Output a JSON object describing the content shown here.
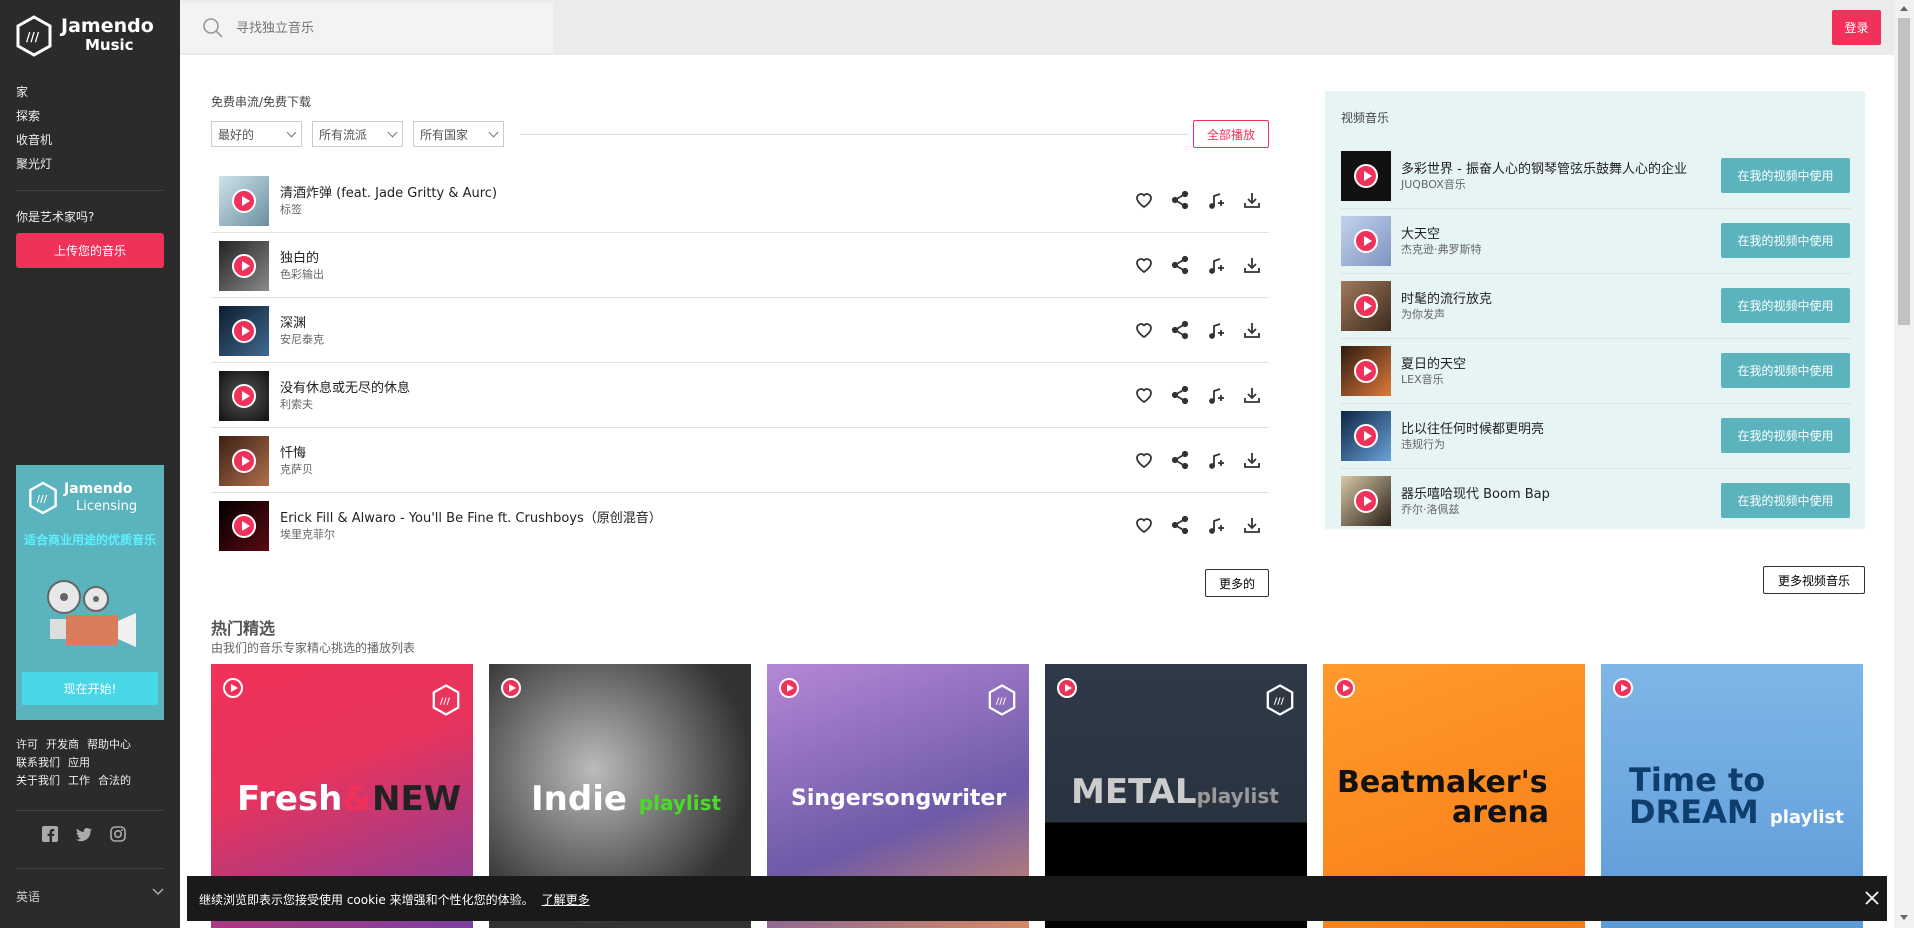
{
  "brand": {
    "name_line1": "Jamendo",
    "name_line2": "Music"
  },
  "sidebar": {
    "nav": [
      {
        "label": "家"
      },
      {
        "label": "探索"
      },
      {
        "label": "收音机"
      },
      {
        "label": "聚光灯"
      }
    ],
    "artist_question": "你是艺术家吗?",
    "upload_label": "上传您的音乐",
    "licensing": {
      "name_line1": "Jamendo",
      "name_line2": "Licensing",
      "tagline": "适合商业用途的优质音乐",
      "cta": "现在开始!"
    },
    "footer_links": [
      "许可",
      "开发商",
      "帮助中心",
      "联系我们",
      "应用",
      "关于我们",
      "工作",
      "合法的"
    ],
    "language": "英语"
  },
  "search": {
    "placeholder": "寻找独立音乐"
  },
  "header": {
    "login_label": "登录"
  },
  "tracks_section": {
    "label": "免费串流/免费下载",
    "filters": [
      {
        "label": "最好的"
      },
      {
        "label": "所有流派"
      },
      {
        "label": "所有国家"
      }
    ],
    "play_all": "全部播放",
    "more": "更多的",
    "tracks": [
      {
        "title": "清酒炸弹 (feat. Jade Gritty & Aurc)",
        "artist": "标签"
      },
      {
        "title": "独白的",
        "artist": "色彩输出"
      },
      {
        "title": "深渊",
        "artist": "安尼泰克"
      },
      {
        "title": "没有休息或无尽的休息",
        "artist": "利索夫"
      },
      {
        "title": "忏悔",
        "artist": "克萨贝"
      },
      {
        "title": "Erick Fill & Alwaro - You'll Be Fine ft. Crushboys（原创混音）",
        "artist": "埃里克菲尔"
      }
    ]
  },
  "video_section": {
    "title": "视频音乐",
    "use_label": "在我的视频中使用",
    "more": "更多视频音乐",
    "items": [
      {
        "title": "多彩世界 - 振奋人心的钢琴管弦乐鼓舞人心的企业",
        "artist": "JUQBOX音乐"
      },
      {
        "title": "大天空",
        "artist": "杰克逊·弗罗斯特"
      },
      {
        "title": "时髦的流行放克",
        "artist": "为你发声"
      },
      {
        "title": "夏日的天空",
        "artist": "LEX音乐"
      },
      {
        "title": "比以往任何时候都更明亮",
        "artist": "违规行为"
      },
      {
        "title": "器乐嘻哈现代 Boom Bap",
        "artist": "乔尔·洛佩兹"
      }
    ]
  },
  "featured": {
    "title": "热门精选",
    "subtitle": "由我们的音乐专家精心挑选的播放列表",
    "playlists": [
      {
        "name_a": "Fresh",
        "name_amp": "&",
        "name_b": "NEW"
      },
      {
        "name_a": "Indie",
        "name_b": "playlist"
      },
      {
        "name_a": "Singersongwriter"
      },
      {
        "name_a": "METAL",
        "name_b": "playlist"
      },
      {
        "name_a": "Beatmaker's",
        "name_b": "arena"
      },
      {
        "name_a": "Time to",
        "name_b": "DREAM",
        "name_c": "playlist"
      }
    ]
  },
  "cookie": {
    "message": "继续浏览即表示您接受使用 cookie 来增强和个性化您的体验。",
    "learn_more": "了解更多"
  },
  "colors": {
    "accent": "#f0325a",
    "teal": "#5bb4bd",
    "sidebar_bg": "#2b2b2b"
  }
}
